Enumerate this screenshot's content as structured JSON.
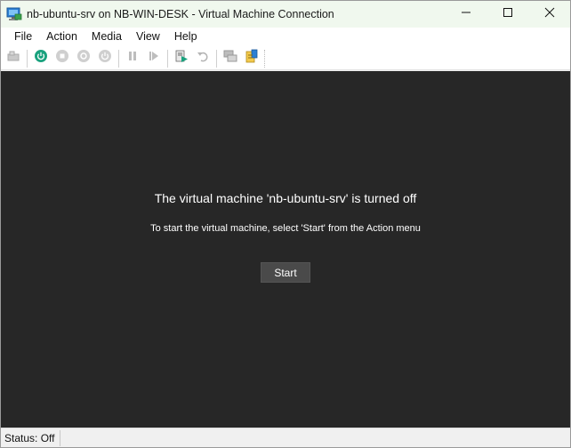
{
  "window": {
    "title": "nb-ubuntu-srv on NB-WIN-DESK - Virtual Machine Connection",
    "app_icon": "vm-connection-icon",
    "controls": [
      "minimize-icon",
      "maximize-icon",
      "close-icon"
    ]
  },
  "menubar": {
    "items": [
      {
        "label": "File"
      },
      {
        "label": "Action"
      },
      {
        "label": "Media"
      },
      {
        "label": "View"
      },
      {
        "label": "Help"
      }
    ]
  },
  "toolbar": {
    "buttons": [
      "ctrl-alt-del-icon",
      "start-power-icon",
      "turn-off-icon",
      "shut-down-icon",
      "power-save-icon",
      "pause-icon",
      "resume-icon",
      "checkpoint-icon",
      "revert-icon",
      "enhanced-session-icon",
      "share-icon"
    ],
    "accent_color": "#1aa27e"
  },
  "content": {
    "background": "#272727",
    "message_title": "The virtual machine 'nb-ubuntu-srv' is turned off",
    "message_hint": "To start the virtual machine, select 'Start' from the Action menu",
    "start_button_label": "Start"
  },
  "statusbar": {
    "status": "Status: Off"
  }
}
